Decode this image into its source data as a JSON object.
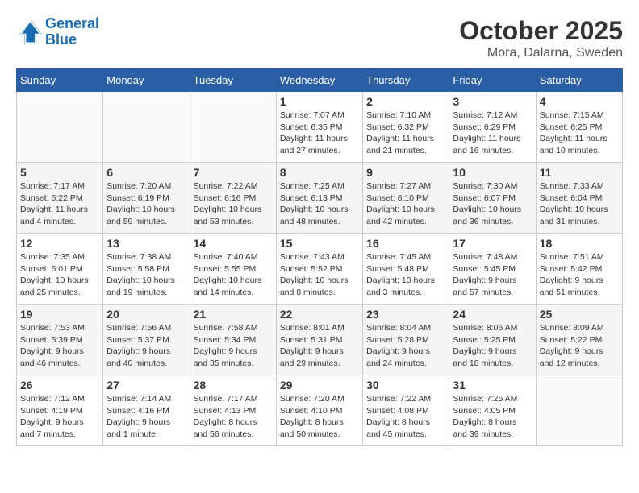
{
  "header": {
    "logo_line1": "General",
    "logo_line2": "Blue",
    "month": "October 2025",
    "location": "Mora, Dalarna, Sweden"
  },
  "weekdays": [
    "Sunday",
    "Monday",
    "Tuesday",
    "Wednesday",
    "Thursday",
    "Friday",
    "Saturday"
  ],
  "weeks": [
    [
      {
        "day": "",
        "info": ""
      },
      {
        "day": "",
        "info": ""
      },
      {
        "day": "",
        "info": ""
      },
      {
        "day": "1",
        "info": "Sunrise: 7:07 AM\nSunset: 6:35 PM\nDaylight: 11 hours\nand 27 minutes."
      },
      {
        "day": "2",
        "info": "Sunrise: 7:10 AM\nSunset: 6:32 PM\nDaylight: 11 hours\nand 21 minutes."
      },
      {
        "day": "3",
        "info": "Sunrise: 7:12 AM\nSunset: 6:29 PM\nDaylight: 11 hours\nand 16 minutes."
      },
      {
        "day": "4",
        "info": "Sunrise: 7:15 AM\nSunset: 6:25 PM\nDaylight: 11 hours\nand 10 minutes."
      }
    ],
    [
      {
        "day": "5",
        "info": "Sunrise: 7:17 AM\nSunset: 6:22 PM\nDaylight: 11 hours\nand 4 minutes."
      },
      {
        "day": "6",
        "info": "Sunrise: 7:20 AM\nSunset: 6:19 PM\nDaylight: 10 hours\nand 59 minutes."
      },
      {
        "day": "7",
        "info": "Sunrise: 7:22 AM\nSunset: 6:16 PM\nDaylight: 10 hours\nand 53 minutes."
      },
      {
        "day": "8",
        "info": "Sunrise: 7:25 AM\nSunset: 6:13 PM\nDaylight: 10 hours\nand 48 minutes."
      },
      {
        "day": "9",
        "info": "Sunrise: 7:27 AM\nSunset: 6:10 PM\nDaylight: 10 hours\nand 42 minutes."
      },
      {
        "day": "10",
        "info": "Sunrise: 7:30 AM\nSunset: 6:07 PM\nDaylight: 10 hours\nand 36 minutes."
      },
      {
        "day": "11",
        "info": "Sunrise: 7:33 AM\nSunset: 6:04 PM\nDaylight: 10 hours\nand 31 minutes."
      }
    ],
    [
      {
        "day": "12",
        "info": "Sunrise: 7:35 AM\nSunset: 6:01 PM\nDaylight: 10 hours\nand 25 minutes."
      },
      {
        "day": "13",
        "info": "Sunrise: 7:38 AM\nSunset: 5:58 PM\nDaylight: 10 hours\nand 19 minutes."
      },
      {
        "day": "14",
        "info": "Sunrise: 7:40 AM\nSunset: 5:55 PM\nDaylight: 10 hours\nand 14 minutes."
      },
      {
        "day": "15",
        "info": "Sunrise: 7:43 AM\nSunset: 5:52 PM\nDaylight: 10 hours\nand 8 minutes."
      },
      {
        "day": "16",
        "info": "Sunrise: 7:45 AM\nSunset: 5:48 PM\nDaylight: 10 hours\nand 3 minutes."
      },
      {
        "day": "17",
        "info": "Sunrise: 7:48 AM\nSunset: 5:45 PM\nDaylight: 9 hours\nand 57 minutes."
      },
      {
        "day": "18",
        "info": "Sunrise: 7:51 AM\nSunset: 5:42 PM\nDaylight: 9 hours\nand 51 minutes."
      }
    ],
    [
      {
        "day": "19",
        "info": "Sunrise: 7:53 AM\nSunset: 5:39 PM\nDaylight: 9 hours\nand 46 minutes."
      },
      {
        "day": "20",
        "info": "Sunrise: 7:56 AM\nSunset: 5:37 PM\nDaylight: 9 hours\nand 40 minutes."
      },
      {
        "day": "21",
        "info": "Sunrise: 7:58 AM\nSunset: 5:34 PM\nDaylight: 9 hours\nand 35 minutes."
      },
      {
        "day": "22",
        "info": "Sunrise: 8:01 AM\nSunset: 5:31 PM\nDaylight: 9 hours\nand 29 minutes."
      },
      {
        "day": "23",
        "info": "Sunrise: 8:04 AM\nSunset: 5:28 PM\nDaylight: 9 hours\nand 24 minutes."
      },
      {
        "day": "24",
        "info": "Sunrise: 8:06 AM\nSunset: 5:25 PM\nDaylight: 9 hours\nand 18 minutes."
      },
      {
        "day": "25",
        "info": "Sunrise: 8:09 AM\nSunset: 5:22 PM\nDaylight: 9 hours\nand 12 minutes."
      }
    ],
    [
      {
        "day": "26",
        "info": "Sunrise: 7:12 AM\nSunset: 4:19 PM\nDaylight: 9 hours\nand 7 minutes."
      },
      {
        "day": "27",
        "info": "Sunrise: 7:14 AM\nSunset: 4:16 PM\nDaylight: 9 hours\nand 1 minute."
      },
      {
        "day": "28",
        "info": "Sunrise: 7:17 AM\nSunset: 4:13 PM\nDaylight: 8 hours\nand 56 minutes."
      },
      {
        "day": "29",
        "info": "Sunrise: 7:20 AM\nSunset: 4:10 PM\nDaylight: 8 hours\nand 50 minutes."
      },
      {
        "day": "30",
        "info": "Sunrise: 7:22 AM\nSunset: 4:08 PM\nDaylight: 8 hours\nand 45 minutes."
      },
      {
        "day": "31",
        "info": "Sunrise: 7:25 AM\nSunset: 4:05 PM\nDaylight: 8 hours\nand 39 minutes."
      },
      {
        "day": "",
        "info": ""
      }
    ]
  ]
}
